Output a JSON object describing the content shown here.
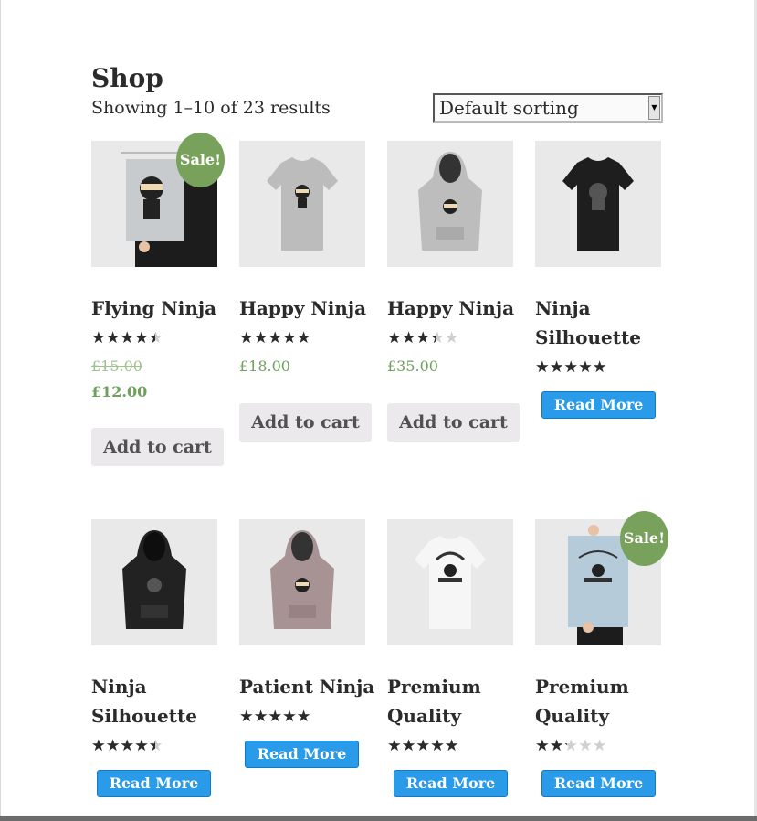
{
  "shop": {
    "title": "Shop",
    "result_count": "Showing 1–10 of 23 results",
    "sort_selected": "Default sorting"
  },
  "products": [
    {
      "title": "Flying Ninja",
      "rating": 4,
      "old_price": "£15.00",
      "price": "£12.00",
      "sale_label": "Sale!",
      "button": "Add to cart",
      "image": "poster-ninja-icon"
    },
    {
      "title": "Happy Ninja",
      "rating": 5,
      "price": "£18.00",
      "button": "Add to cart",
      "image": "grey-tshirt-icon"
    },
    {
      "title": "Happy Ninja",
      "rating": 3,
      "price": "£35.00",
      "button": "Add to cart",
      "image": "grey-hoodie-icon"
    },
    {
      "title": "Ninja Silhouette",
      "rating": 5,
      "button": "Read More",
      "image": "black-tshirt-icon"
    },
    {
      "title": "Ninja Silhouette",
      "rating": 4,
      "button": "Read More",
      "image": "black-hoodie-icon"
    },
    {
      "title": "Patient Ninja",
      "rating": 5,
      "button": "Read More",
      "image": "mauve-hoodie-icon"
    },
    {
      "title": "Premium Quality",
      "rating": 4.5,
      "button": "Read More",
      "image": "white-tshirt-icon"
    },
    {
      "title": "Premium Quality",
      "rating": 2,
      "sale_label": "Sale!",
      "button": "Read More",
      "image": "poster-woothemes-icon"
    }
  ],
  "colors": {
    "accent_blue": "#2a9be8",
    "sale_green": "#78a25c",
    "price_green": "#6fa05c",
    "cart_button_bg": "#ebe9eb"
  }
}
